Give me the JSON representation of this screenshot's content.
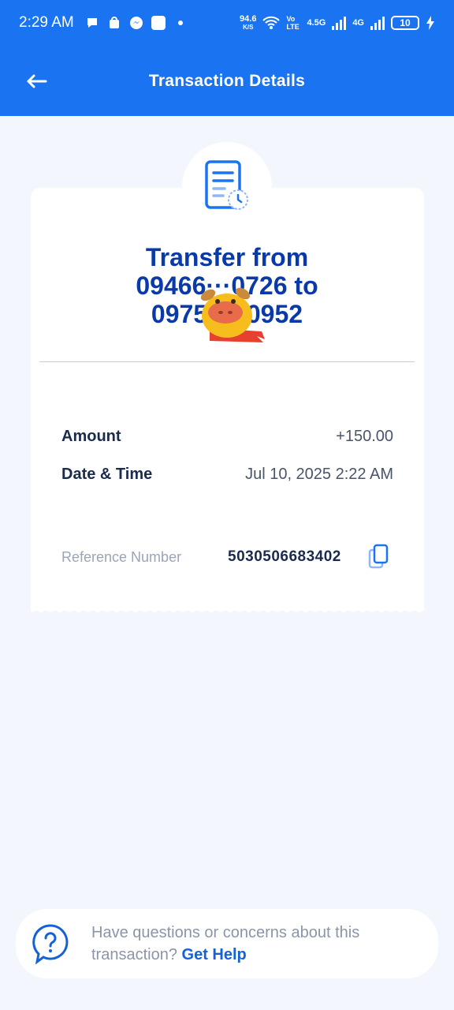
{
  "status_bar": {
    "time": "2:29 AM",
    "net_speed_value": "94.6",
    "net_speed_unit": "K/S",
    "volte": "Vo LTE",
    "network_1": "4.5G",
    "network_2": "4G",
    "battery": "10"
  },
  "header": {
    "title": "Transaction Details"
  },
  "receipt": {
    "title_line1": "Transfer from",
    "title_line2": "09466···0726 to",
    "title_line3": "09751···0952",
    "amount_label": "Amount",
    "amount_value": "+150.00",
    "datetime_label": "Date & Time",
    "datetime_value": "Jul 10, 2025 2:22 AM",
    "reference_label": "Reference Number",
    "reference_value": "5030506683402"
  },
  "help": {
    "text": "Have questions or concerns about this transaction?",
    "link": "Get Help"
  },
  "colors": {
    "primary": "#1a73f0",
    "title_blue": "#0a3aa8",
    "link_blue": "#1462d6",
    "background": "#f3f7fd"
  }
}
